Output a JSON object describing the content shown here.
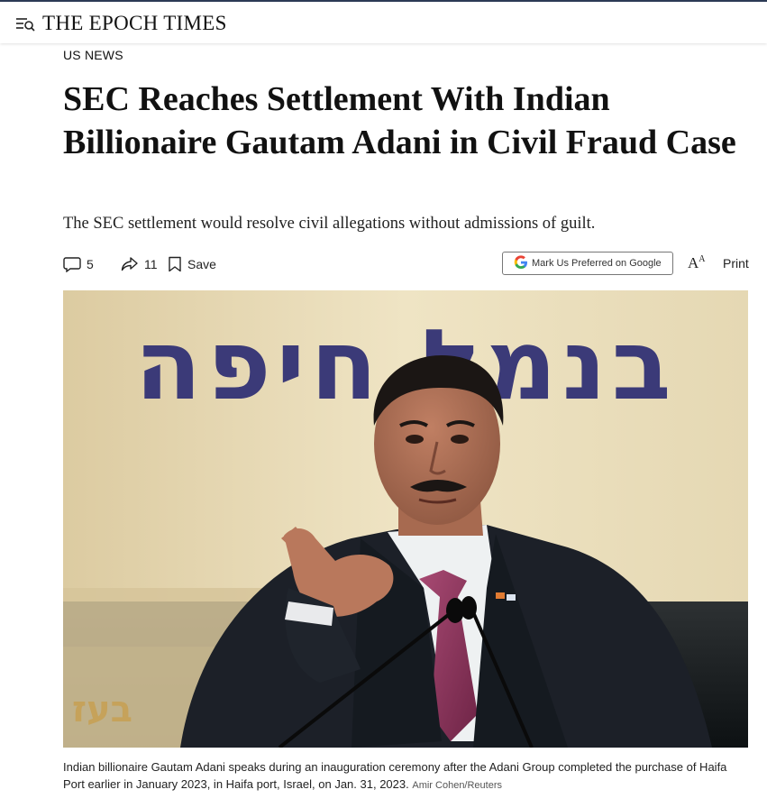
{
  "header": {
    "logo_text": "THE EPOCH TIMES",
    "menu_icon": "menu-search-icon"
  },
  "article": {
    "section": "US NEWS",
    "headline": "SEC Reaches Settlement With Indian Billionaire Gautam Adani in Civil Fraud Case",
    "subheadline": "The SEC settlement would resolve civil allegations without admissions of guilt."
  },
  "actions": {
    "comments_count": "5",
    "shares_count": "11",
    "save_label": "Save",
    "google_label": "Mark Us Preferred on Google",
    "font_size_glyph": "A",
    "font_size_glyph_small": "A",
    "print_label": "Print"
  },
  "photo": {
    "banner_text": "בנמל חיפה",
    "lower_banner_text": "בעז",
    "caption": "Indian billionaire Gautam Adani speaks during an inauguration ceremony after the Adani Group completed the purchase of Haifa Port earlier in January 2023, in Haifa port, Israel, on Jan. 31, 2023.",
    "credit": "Amir Cohen/Reuters"
  },
  "colors": {
    "top_border": "#2b3a55",
    "banner_bg": "#e9dcb8",
    "banner_text": "#3b3a78",
    "stage_dark": "#141a1e"
  }
}
